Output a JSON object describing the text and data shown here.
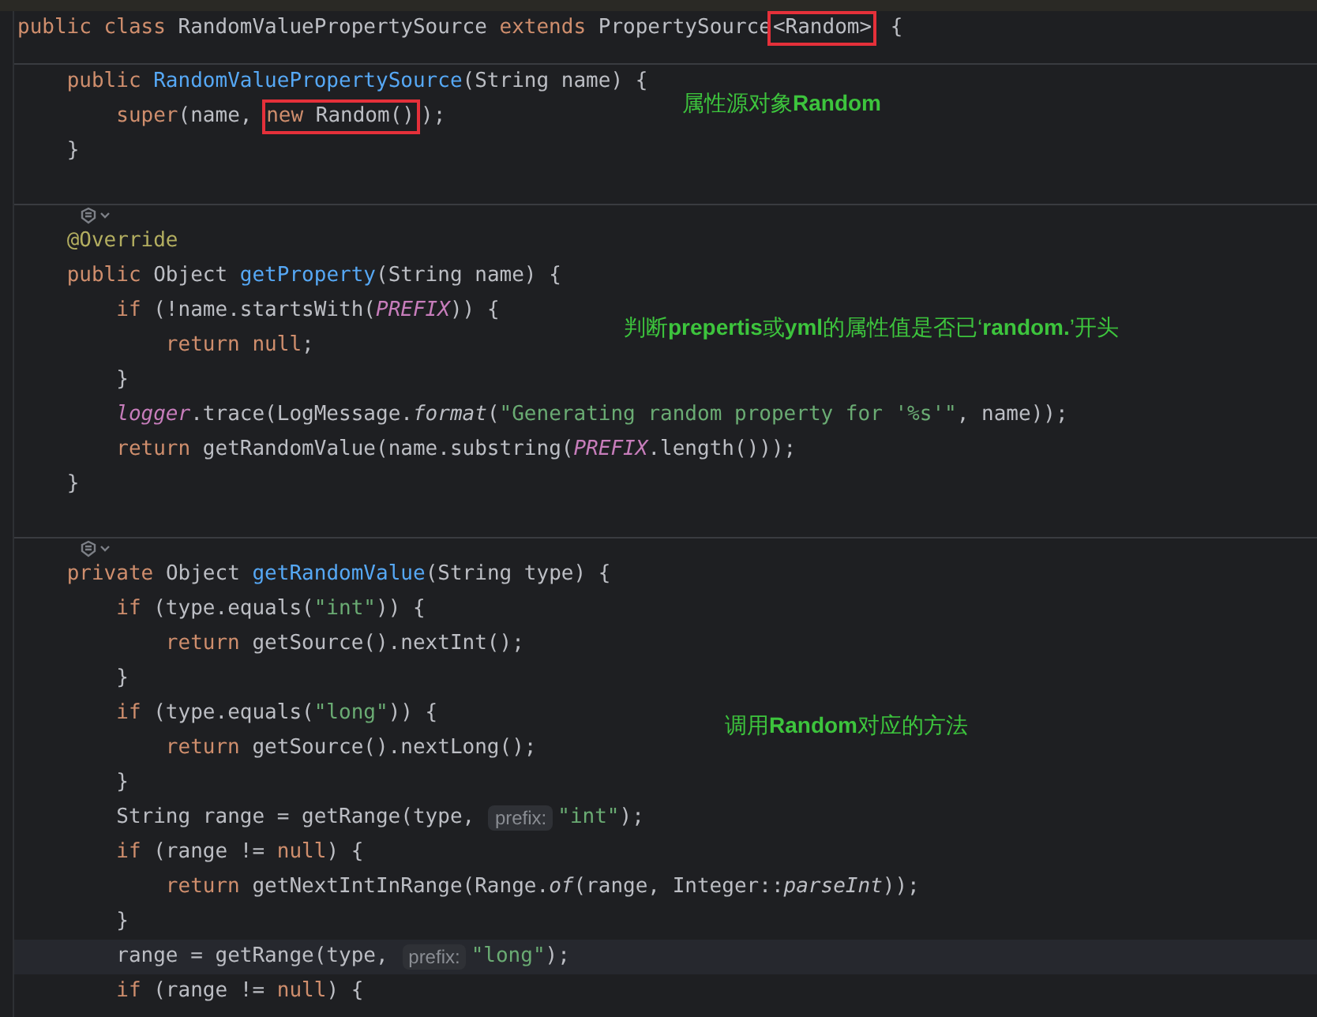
{
  "editor": {
    "lines": [
      {
        "kind": "code",
        "tokens": [
          {
            "text": "public class ",
            "kind": "keyword"
          },
          {
            "text": "RandomValuePropertySource ",
            "kind": "plain"
          },
          {
            "text": "extends ",
            "kind": "keyword"
          },
          {
            "text": "PropertySource",
            "kind": "plain"
          },
          {
            "kind": "box",
            "tokens": [
              {
                "text": "<Random>",
                "kind": "plain"
              }
            ]
          },
          {
            "text": " {",
            "kind": "plain"
          }
        ]
      },
      {
        "kind": "divider",
        "gutter_icon": false
      },
      {
        "kind": "code",
        "tokens": [
          {
            "text": "    public ",
            "kind": "keyword"
          },
          {
            "text": "RandomValuePropertySource",
            "kind": "method"
          },
          {
            "text": "(String name) {",
            "kind": "plain"
          }
        ]
      },
      {
        "kind": "code",
        "note": "属性源对象**Random**",
        "tokens": [
          {
            "text": "        super",
            "kind": "keyword"
          },
          {
            "text": "(name, ",
            "kind": "plain"
          },
          {
            "kind": "box",
            "tokens": [
              {
                "text": "new ",
                "kind": "keyword"
              },
              {
                "text": "Random()",
                "kind": "plain"
              }
            ]
          },
          {
            "text": ");",
            "kind": "plain"
          }
        ]
      },
      {
        "kind": "code",
        "tokens": [
          {
            "text": "    }",
            "kind": "plain"
          }
        ]
      },
      {
        "kind": "blank"
      },
      {
        "kind": "divider",
        "gutter_icon": true
      },
      {
        "kind": "code",
        "tokens": [
          {
            "text": "    @Override",
            "kind": "annotation"
          }
        ]
      },
      {
        "kind": "code",
        "tokens": [
          {
            "text": "    public ",
            "kind": "keyword"
          },
          {
            "text": "Object ",
            "kind": "plain"
          },
          {
            "text": "getProperty",
            "kind": "method"
          },
          {
            "text": "(String name) {",
            "kind": "plain"
          }
        ]
      },
      {
        "kind": "code",
        "tokens": [
          {
            "text": "        if ",
            "kind": "keyword"
          },
          {
            "text": "(!name.startsWith(",
            "kind": "plain"
          },
          {
            "text": "PREFIX",
            "kind": "field"
          },
          {
            "text": ")) {",
            "kind": "plain"
          }
        ]
      },
      {
        "kind": "code",
        "note": "判断**prepertis**或**yml**的属性值是否已‘**random.**’开头",
        "tokens": [
          {
            "text": "            return null",
            "kind": "keyword"
          },
          {
            "text": ";",
            "kind": "plain"
          }
        ]
      },
      {
        "kind": "code",
        "tokens": [
          {
            "text": "        }",
            "kind": "plain"
          }
        ]
      },
      {
        "kind": "code",
        "tokens": [
          {
            "text": "        logger",
            "kind": "field"
          },
          {
            "text": ".trace(LogMessage.",
            "kind": "plain"
          },
          {
            "text": "format",
            "kind": "static"
          },
          {
            "text": "(",
            "kind": "plain"
          },
          {
            "text": "\"Generating random property for '%s'\"",
            "kind": "string"
          },
          {
            "text": ", name));",
            "kind": "plain"
          }
        ]
      },
      {
        "kind": "code",
        "tokens": [
          {
            "text": "        return ",
            "kind": "keyword"
          },
          {
            "text": "getRandomValue(name.substring(",
            "kind": "plain"
          },
          {
            "text": "PREFIX",
            "kind": "field"
          },
          {
            "text": ".length()));",
            "kind": "plain"
          }
        ]
      },
      {
        "kind": "code",
        "tokens": [
          {
            "text": "    }",
            "kind": "plain"
          }
        ]
      },
      {
        "kind": "blank"
      },
      {
        "kind": "divider",
        "gutter_icon": true
      },
      {
        "kind": "code",
        "tokens": [
          {
            "text": "    private ",
            "kind": "keyword"
          },
          {
            "text": "Object ",
            "kind": "plain"
          },
          {
            "text": "getRandomValue",
            "kind": "method"
          },
          {
            "text": "(String type) {",
            "kind": "plain"
          }
        ]
      },
      {
        "kind": "code",
        "tokens": [
          {
            "text": "        if ",
            "kind": "keyword"
          },
          {
            "text": "(type.equals(",
            "kind": "plain"
          },
          {
            "text": "\"int\"",
            "kind": "string"
          },
          {
            "text": ")) {",
            "kind": "plain"
          }
        ]
      },
      {
        "kind": "code",
        "tokens": [
          {
            "text": "            return ",
            "kind": "keyword"
          },
          {
            "text": "getSource().nextInt();",
            "kind": "plain"
          }
        ]
      },
      {
        "kind": "code",
        "tokens": [
          {
            "text": "        }",
            "kind": "plain"
          }
        ]
      },
      {
        "kind": "code",
        "tokens": [
          {
            "text": "        if ",
            "kind": "keyword"
          },
          {
            "text": "(type.equals(",
            "kind": "plain"
          },
          {
            "text": "\"long\"",
            "kind": "string"
          },
          {
            "text": ")) {",
            "kind": "plain"
          }
        ]
      },
      {
        "kind": "code",
        "note": "调用**Random**对应的方法",
        "tokens": [
          {
            "text": "            return ",
            "kind": "keyword"
          },
          {
            "text": "getSource().nextLong();",
            "kind": "plain"
          }
        ]
      },
      {
        "kind": "code",
        "tokens": [
          {
            "text": "        }",
            "kind": "plain"
          }
        ]
      },
      {
        "kind": "code",
        "tokens": [
          {
            "text": "        String range = getRange(type, ",
            "kind": "plain"
          },
          {
            "text": "prefix:",
            "kind": "hint"
          },
          {
            "text": "\"int\"",
            "kind": "string"
          },
          {
            "text": ");",
            "kind": "plain"
          }
        ]
      },
      {
        "kind": "code",
        "tokens": [
          {
            "text": "        if ",
            "kind": "keyword"
          },
          {
            "text": "(range != ",
            "kind": "plain"
          },
          {
            "text": "null",
            "kind": "keyword"
          },
          {
            "text": ") {",
            "kind": "plain"
          }
        ]
      },
      {
        "kind": "code",
        "tokens": [
          {
            "text": "            return ",
            "kind": "keyword"
          },
          {
            "text": "getNextIntInRange(Range.",
            "kind": "plain"
          },
          {
            "text": "of",
            "kind": "static"
          },
          {
            "text": "(range, Integer::",
            "kind": "plain"
          },
          {
            "text": "parseInt",
            "kind": "static"
          },
          {
            "text": "));",
            "kind": "plain"
          }
        ]
      },
      {
        "kind": "code",
        "tokens": [
          {
            "text": "        }",
            "kind": "plain"
          }
        ]
      },
      {
        "kind": "code",
        "current": true,
        "tokens": [
          {
            "text": "        range = getRange(type, ",
            "kind": "plain"
          },
          {
            "text": "prefix:",
            "kind": "hint"
          },
          {
            "text": "\"long\"",
            "kind": "string"
          },
          {
            "text": ");",
            "kind": "plain"
          }
        ]
      },
      {
        "kind": "code",
        "tokens": [
          {
            "text": "        if ",
            "kind": "keyword"
          },
          {
            "text": "(range != ",
            "kind": "plain"
          },
          {
            "text": "null",
            "kind": "keyword"
          },
          {
            "text": ") {",
            "kind": "plain"
          }
        ]
      }
    ]
  }
}
